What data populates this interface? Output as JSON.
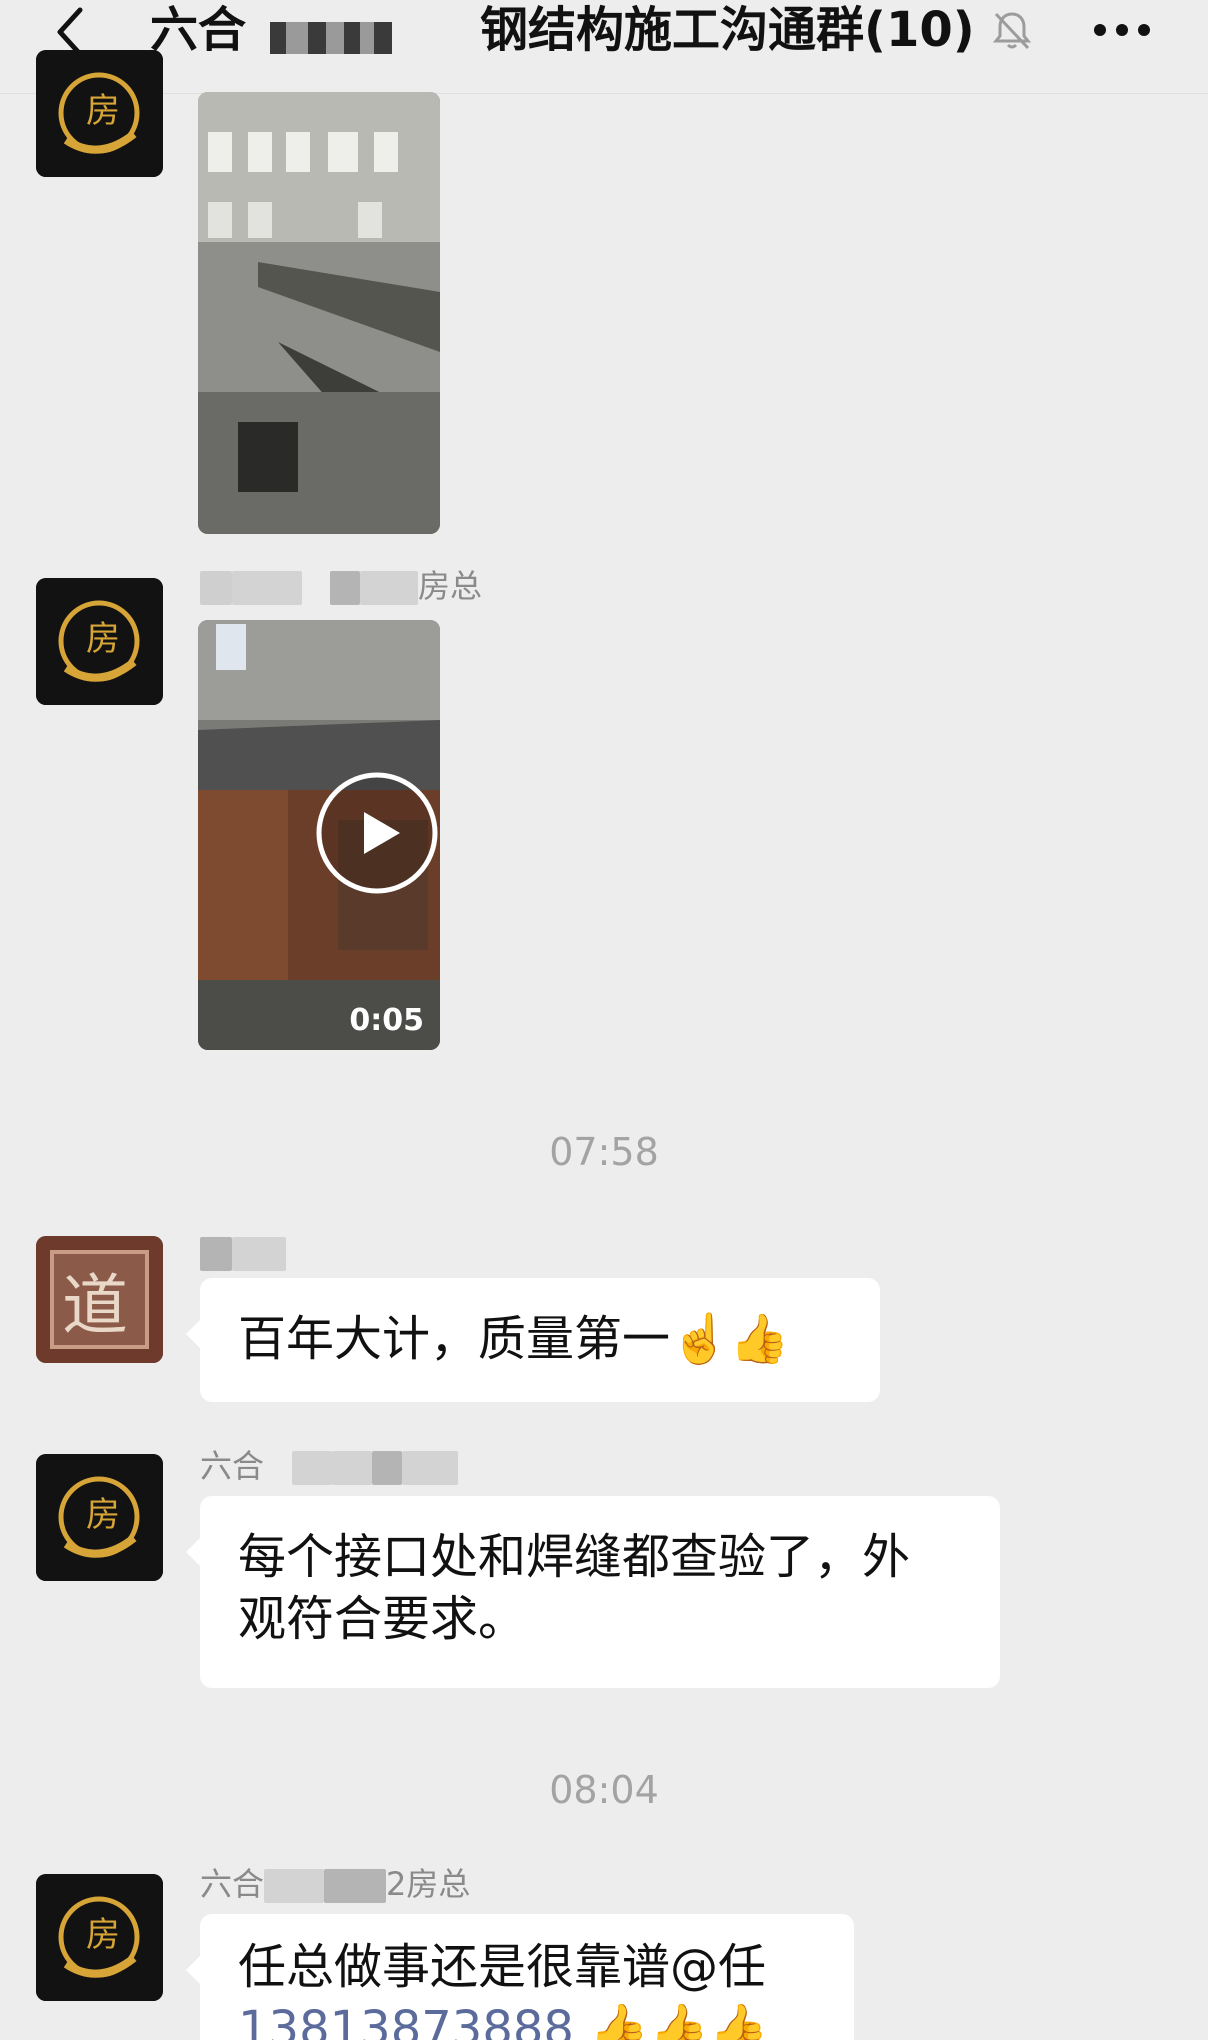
{
  "header": {
    "title_prefix": "六合",
    "title_main": "钢结构施工沟通群(10)"
  },
  "messages": {
    "m1": {
      "type": "image"
    },
    "m2": {
      "sender_suffix": "房总",
      "type": "video",
      "duration": "0:05"
    },
    "time1": "07:58",
    "m3": {
      "text": "百年大计，质量第一",
      "emoji": "☝️👍"
    },
    "m4": {
      "sender_prefix": "六合",
      "text_line1": "每个接口处和焊缝都查验了，外",
      "text_line2": "观符合要求。"
    },
    "time2": "08:04",
    "m5": {
      "sender_prefix": "六合",
      "sender_suffix": "2房总",
      "text": "任总做事还是很靠谱@任",
      "phone": "13813873888",
      "emoji": "👍👍👍"
    }
  },
  "colors": {
    "background": "#ededed",
    "bubble": "#ffffff",
    "link": "#5b6b9b",
    "timestamp": "#a3a3a3"
  }
}
